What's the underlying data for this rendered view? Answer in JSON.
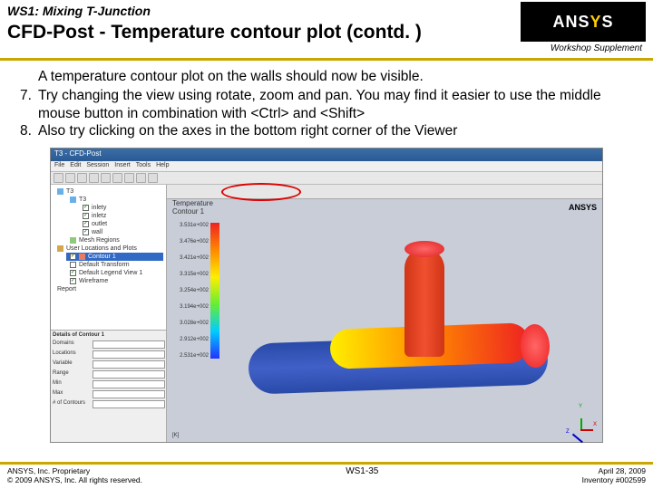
{
  "header": {
    "ws_title": "WS1: Mixing T-Junction",
    "main_title": "CFD-Post - Temperature contour plot (contd. )",
    "supplement": "Workshop Supplement",
    "logo_a": "ANS",
    "logo_y": "Y",
    "logo_s": "S"
  },
  "body": {
    "intro": "A temperature contour plot on the walls should now be visible.",
    "items": [
      {
        "num": "7.",
        "text": "Try changing the view using rotate, zoom and pan.  You may find it easier to use the middle mouse button in combination with <Ctrl> and <Shift>"
      },
      {
        "num": "8.",
        "text": "Also try clicking on the axes in the bottom right corner of the Viewer"
      }
    ]
  },
  "app": {
    "titlebar": "T3 - CFD-Post",
    "menus": [
      "File",
      "Edit",
      "Session",
      "Insert",
      "Tools",
      "Help"
    ],
    "tree": {
      "case": "T3",
      "group1": "T3",
      "items1": [
        "inlety",
        "inletz",
        "outlet",
        "wall"
      ],
      "mesh": "Mesh Regions",
      "uloc": "User Locations and Plots",
      "contour": "Contour 1",
      "extras": [
        "Default Transform",
        "Default Legend View 1",
        "Wireframe"
      ],
      "report": "Report"
    },
    "detail": {
      "title": "Details of Contour 1",
      "rows": [
        "Domains",
        "Locations",
        "Variable",
        "Range",
        "Min",
        "Max",
        "# of Contours"
      ]
    },
    "viewer": {
      "ansys": "ANSYS",
      "leg_title": "Temperature\nContour 1",
      "ticks": [
        "3.531e+002",
        "3.476e+002",
        "3.421e+002",
        "3.315e+002",
        "3.254e+002",
        "3.194e+002",
        "3.028e+002",
        "2.912e+002",
        "2.531e+002"
      ],
      "legend_unit": "[K]",
      "triad": {
        "x": "X",
        "y": "Y",
        "z": "Z"
      }
    }
  },
  "footer": {
    "left1": "ANSYS, Inc. Proprietary",
    "left2": "© 2009 ANSYS, Inc.  All rights reserved.",
    "center": "WS1-35",
    "right1": "April 28, 2009",
    "right2": "Inventory #002599"
  }
}
